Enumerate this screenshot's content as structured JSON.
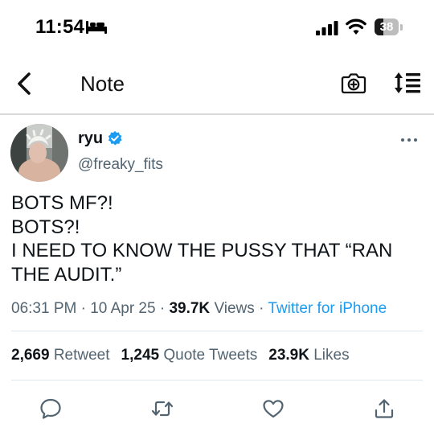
{
  "status_bar": {
    "time": "11:54",
    "battery_level": "38",
    "icons": [
      "bed-icon",
      "cellular-signal-icon",
      "wifi-icon",
      "battery-icon"
    ]
  },
  "nav": {
    "title": "Note",
    "icons": [
      "back-chevron-icon",
      "camera-plus-icon",
      "text-format-icon"
    ]
  },
  "tweet": {
    "display_name": "ryu",
    "username": "@freaky_fits",
    "verified": true,
    "text_lines": [
      "BOTS MF?!",
      "BOTS?!",
      "I NEED TO KNOW THE PUSSY THAT “RAN",
      "THE AUDIT.”"
    ],
    "time": "06:31 PM",
    "date": "10 Apr 25",
    "views_count": "39.7K",
    "views_label": "Views",
    "source": "Twitter for iPhone",
    "separator": "·",
    "retweets_count": "2,669",
    "retweets_label": "Retweet",
    "quotes_count": "1,245",
    "quotes_label": "Quote Tweets",
    "likes_count": "23.9K",
    "likes_label": "Likes"
  },
  "actions": [
    "reply-icon",
    "retweet-icon",
    "like-icon",
    "share-icon"
  ],
  "colors": {
    "link_blue": "#1d9bf0",
    "secondary_text": "#536471",
    "primary_text": "#0f1419"
  }
}
